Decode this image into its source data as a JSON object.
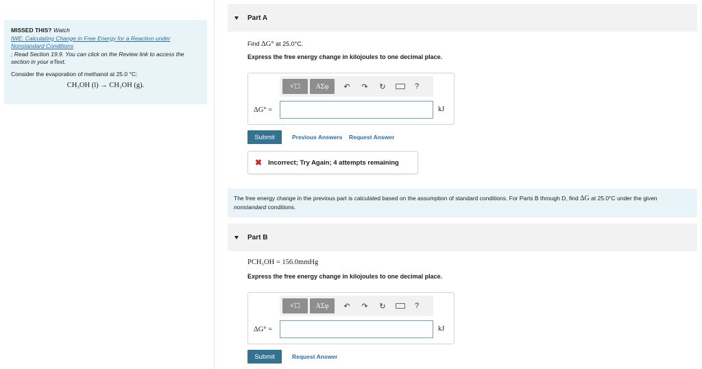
{
  "sidebar": {
    "missed_label": "MISSED THIS?",
    "watch_label": "Watch",
    "iwe_link": "IWE: Calculating Change in Free Energy for a Reaction under Nonstandard Conditions",
    "read_text": "; Read Section 19.9. You can click on the Review link to access the section in your eText.",
    "consider_text": "Consider the evaporation of methanol at 25.0 °C:",
    "reaction": "CH₃OH (l) → CH₃OH (g)."
  },
  "part_a": {
    "header": "Part A",
    "find_prefix": "Find",
    "find_math": "ΔG°",
    "find_suffix": "at 25.0°C.",
    "instruction": "Express the free energy change in kilojoules to one decimal place.",
    "input_label": "ΔG° =",
    "input_value": "",
    "unit": "kJ",
    "submit_label": "Submit",
    "previous_answers_label": "Previous Answers",
    "request_answer_label": "Request Answer",
    "feedback": "Incorrect; Try Again; 4 attempts remaining"
  },
  "note": {
    "text_1": "The free energy change in the previous part is calculated based on the assumption of standard conditions. For Parts B through D, find",
    "math": "ΔG",
    "text_2": "at 25.0°C under the given",
    "emph": "nonstandard",
    "text_3": "conditions."
  },
  "part_b": {
    "header": "Part B",
    "pressure": "PCH₃OH = 156.0mmHg",
    "instruction": "Express the free energy change in kilojoules to one decimal place.",
    "input_label": "ΔG° =",
    "input_value": "",
    "unit": "kJ",
    "submit_label": "Submit",
    "request_answer_label": "Request Answer"
  },
  "toolbar": {
    "template_btn": "√□",
    "symbols_btn": "ΑΣφ",
    "undo_icon": "↶",
    "redo_icon": "↷",
    "reset_icon": "↻",
    "help_label": "?"
  }
}
